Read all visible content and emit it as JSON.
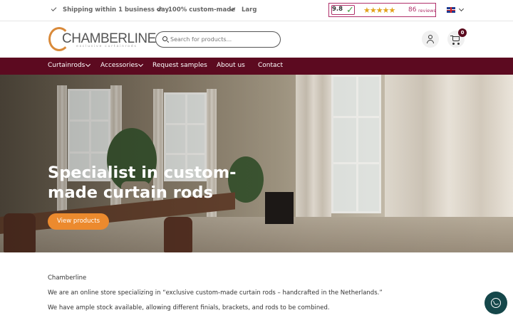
{
  "topbar": {
    "usps": [
      "Shipping within 1 business day",
      "100% custom-made",
      "Larg"
    ],
    "rating": {
      "score": "9.8",
      "stars": "★★★★★",
      "count": "86",
      "reviews_label": "reviews"
    },
    "language": "en-flag-icon"
  },
  "header": {
    "logo_text": "CHAMBERLINE",
    "logo_sub": "exclusive curtainrods",
    "search_placeholder": "Search for products...",
    "cart_count": "0"
  },
  "nav": {
    "items": [
      {
        "label": "Curtainrods",
        "has_dropdown": true
      },
      {
        "label": "Accessories",
        "has_dropdown": true
      },
      {
        "label": "Request samples",
        "has_dropdown": false
      },
      {
        "label": "About us",
        "has_dropdown": false
      },
      {
        "label": "Contact",
        "has_dropdown": false
      }
    ]
  },
  "hero": {
    "title": "Specialist in custom-made curtain rods",
    "button_label": "View products"
  },
  "content": {
    "heading": "Chamberline",
    "paragraphs": [
      "We are an online store specializing in “exclusive custom-made curtain rods – handcrafted in the Netherlands.”",
      "We have ample stock available, allowing different finials, brackets, and rods to be combined."
    ]
  },
  "colors": {
    "brand": "#5c0a20",
    "accent": "#ec8a2e",
    "whatsapp": "#15474a"
  }
}
